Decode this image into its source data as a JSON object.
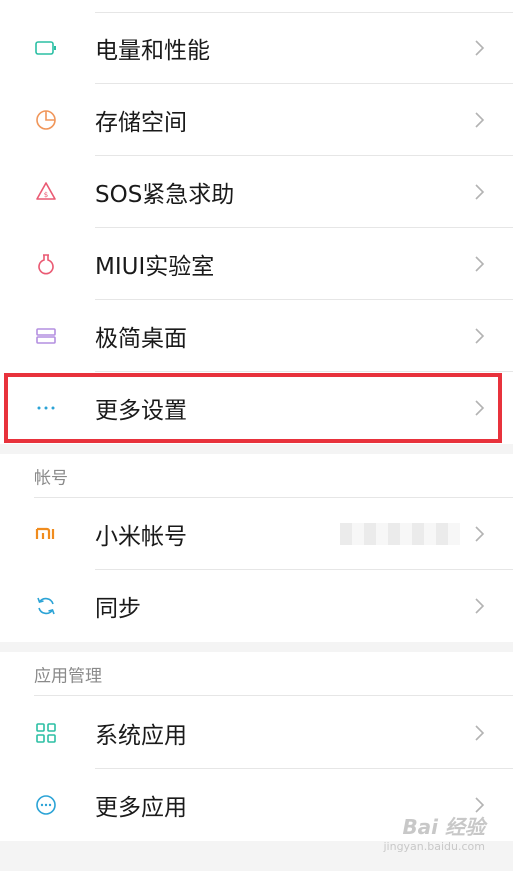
{
  "system_section": {
    "items": [
      {
        "label": "电量和性能",
        "icon": "battery-icon",
        "icon_color": "#2bbfa4"
      },
      {
        "label": "存储空间",
        "icon": "storage-pie-icon",
        "icon_color": "#f0965a"
      },
      {
        "label": "SOS紧急求助",
        "icon": "sos-alert-icon",
        "icon_color": "#ea5a73"
      },
      {
        "label": "MIUI实验室",
        "icon": "flask-icon",
        "icon_color": "#ea5a73"
      },
      {
        "label": "极简桌面",
        "icon": "layout-icon",
        "icon_color": "#b48fe0"
      },
      {
        "label": "更多设置",
        "icon": "more-dots-icon",
        "icon_color": "#2ba3d6"
      }
    ]
  },
  "account_section": {
    "title": "帐号",
    "items": [
      {
        "label": "小米帐号",
        "icon": "mi-logo-icon",
        "icon_color": "#f08c1e"
      },
      {
        "label": "同步",
        "icon": "sync-icon",
        "icon_color": "#2ba3d6"
      }
    ]
  },
  "apps_section": {
    "title": "应用管理",
    "items": [
      {
        "label": "系统应用",
        "icon": "grid-icon",
        "icon_color": "#2bbfa4"
      },
      {
        "label": "更多应用",
        "icon": "more-circle-icon",
        "icon_color": "#2ba3d6"
      }
    ]
  },
  "watermark": {
    "main": "Bai 经验",
    "sub": "jingyan.baidu.com"
  },
  "highlight_color": "#e8323c"
}
